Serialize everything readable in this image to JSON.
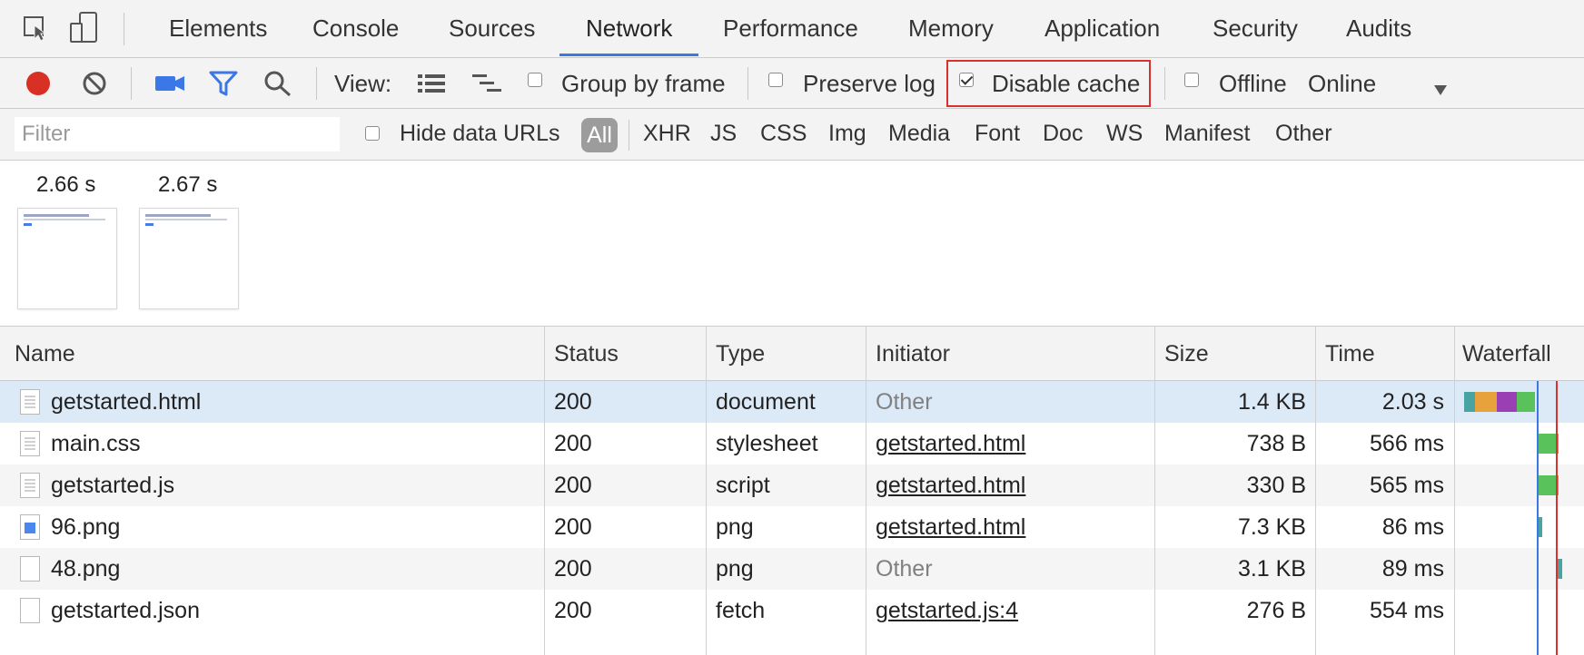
{
  "tabs": [
    "Elements",
    "Console",
    "Sources",
    "Network",
    "Performance",
    "Memory",
    "Application",
    "Security",
    "Audits"
  ],
  "active_tab": "Network",
  "toolbar": {
    "view_label": "View:",
    "group_by_frame": "Group by frame",
    "preserve_log": "Preserve log",
    "disable_cache": "Disable cache",
    "offline": "Offline",
    "throttling": "Online",
    "group_by_frame_checked": false,
    "preserve_log_checked": false,
    "disable_cache_checked": true,
    "offline_checked": false
  },
  "filter": {
    "placeholder": "Filter",
    "hide_data_urls": "Hide data URLs",
    "types": [
      "All",
      "XHR",
      "JS",
      "CSS",
      "Img",
      "Media",
      "Font",
      "Doc",
      "WS",
      "Manifest",
      "Other"
    ],
    "active_type": "All"
  },
  "filmstrip": [
    {
      "time": "2.66 s"
    },
    {
      "time": "2.67 s"
    }
  ],
  "columns": {
    "name": "Name",
    "status": "Status",
    "type": "Type",
    "initiator": "Initiator",
    "size": "Size",
    "time": "Time",
    "waterfall": "Waterfall"
  },
  "rows": [
    {
      "name": "getstarted.html",
      "status": "200",
      "type": "document",
      "initiator": "Other",
      "size": "1.4 KB",
      "time": "2.03 s",
      "icon": "document-icon"
    },
    {
      "name": "main.css",
      "status": "200",
      "type": "stylesheet",
      "initiator": "getstarted.html",
      "size": "738 B",
      "time": "566 ms",
      "icon": "document-icon"
    },
    {
      "name": "getstarted.js",
      "status": "200",
      "type": "script",
      "initiator": "getstarted.html",
      "size": "330 B",
      "time": "565 ms",
      "icon": "document-icon"
    },
    {
      "name": "96.png",
      "status": "200",
      "type": "png",
      "initiator": "getstarted.html",
      "size": "7.3 KB",
      "time": "86 ms",
      "icon": "image-icon"
    },
    {
      "name": "48.png",
      "status": "200",
      "type": "png",
      "initiator": "Other",
      "size": "3.1 KB",
      "time": "89 ms",
      "icon": "blank-file-icon"
    },
    {
      "name": "getstarted.json",
      "status": "200",
      "type": "fetch",
      "initiator": "getstarted.js:4",
      "size": "276 B",
      "time": "554 ms",
      "icon": "blank-file-icon"
    }
  ],
  "colors": {
    "record": "#d93025",
    "accent": "#3b78e7",
    "highlight": "#d9312b",
    "waterfall_green": "#5ac25a",
    "waterfall_orange": "#e8a23c",
    "waterfall_purple": "#9b3fb5",
    "waterfall_teal": "#4aa3a3"
  }
}
